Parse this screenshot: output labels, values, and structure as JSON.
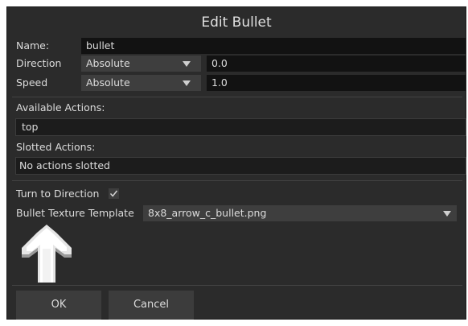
{
  "dialog": {
    "title": "Edit Bullet"
  },
  "form": {
    "name_label": "Name:",
    "name_value": "bullet",
    "direction_label": "Direction",
    "direction_mode": "Absolute",
    "direction_value": "0.0",
    "speed_label": "Speed",
    "speed_mode": "Absolute",
    "speed_value": "1.0"
  },
  "actions": {
    "available_label": "Available Actions:",
    "available_items": [
      "top"
    ],
    "slotted_label": "Slotted Actions:",
    "slotted_placeholder": "No actions slotted"
  },
  "options": {
    "turn_label": "Turn to Direction",
    "turn_checked": true,
    "texture_label": "Bullet Texture Template",
    "texture_value": "8x8_arrow_c_bullet.png"
  },
  "buttons": {
    "ok": "OK",
    "cancel": "Cancel"
  },
  "icons": {
    "dropdown": "chevron-down-icon",
    "check": "checkmark-icon",
    "preview": "bullet-arrow-preview"
  },
  "colors": {
    "panel": "#2b2b2b",
    "field": "#121212",
    "combo": "#3e3e3e",
    "button": "#3c3c3c",
    "text": "#dcdcdc"
  }
}
